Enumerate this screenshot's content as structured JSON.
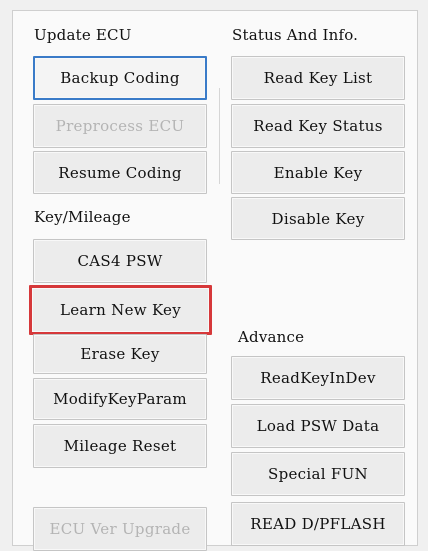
{
  "sections": {
    "update_ecu": "Update ECU",
    "status_info": "Status And Info.",
    "key_mileage": "Key/Mileage",
    "advance": "Advance"
  },
  "buttons": {
    "backup_coding": "Backup Coding",
    "preprocess_ecu": "Preprocess ECU",
    "resume_coding": "Resume Coding",
    "cas4_psw": "CAS4 PSW",
    "learn_new_key": "Learn New Key",
    "erase_key": "Erase Key",
    "modify_key_param": "ModifyKeyParam",
    "mileage_reset": "Mileage Reset",
    "ecu_ver_upgrade": "ECU Ver Upgrade",
    "read_key_list": "Read Key List",
    "read_key_status": "Read Key Status",
    "enable_key": "Enable Key",
    "disable_key": "Disable Key",
    "read_key_in_dev": "ReadKeyInDev",
    "load_psw_data": "Load PSW Data",
    "special_fun": "Special FUN",
    "read_d_pflash": "READ D/PFLASH"
  },
  "colors": {
    "highlight_border": "#d6383a",
    "focus_border": "#3a7bc8",
    "disabled_text": "#b4b4b4"
  }
}
